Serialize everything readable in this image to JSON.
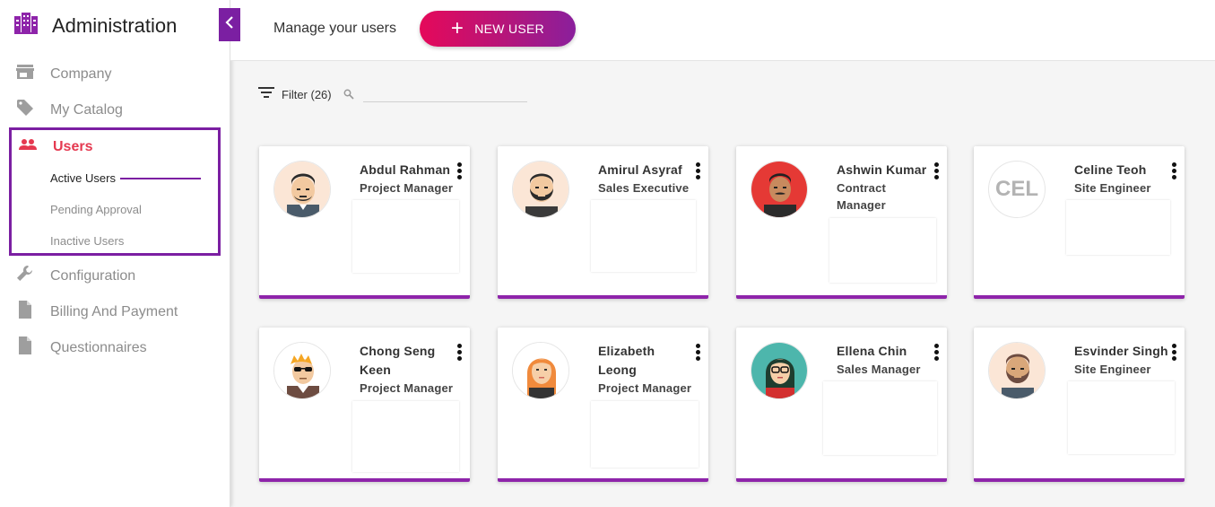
{
  "app": {
    "title": "Administration"
  },
  "sidebar": {
    "items": [
      {
        "label": "Company",
        "icon": "store-icon"
      },
      {
        "label": "My Catalog",
        "icon": "tag-icon"
      },
      {
        "label": "Users",
        "icon": "people-icon"
      },
      {
        "label": "Configuration",
        "icon": "wrench-icon"
      },
      {
        "label": "Billing And Payment",
        "icon": "document-icon"
      },
      {
        "label": "Questionnaires",
        "icon": "document-icon"
      }
    ],
    "users_subitems": [
      {
        "label": "Active Users"
      },
      {
        "label": "Pending Approval"
      },
      {
        "label": "Inactive Users"
      }
    ]
  },
  "header": {
    "title": "Manage your users",
    "new_user_label": "NEW USER"
  },
  "filter": {
    "label": "Filter (26)",
    "search_value": ""
  },
  "users": [
    {
      "name": "Abdul Rahman",
      "role": "Project Manager",
      "avatar": "man-beard-avatar"
    },
    {
      "name": "Amirul Asyraf",
      "role": "Sales Executive",
      "avatar": "man-full-beard-avatar"
    },
    {
      "name": "Ashwin Kumar",
      "role": "Contract Manager",
      "avatar": "man-mustache-red-avatar"
    },
    {
      "name": "Celine Teoh",
      "role": "Site Engineer",
      "avatar": "initials-avatar",
      "initials": "CEL"
    },
    {
      "name": "Chong Seng Keen",
      "role": "Project Manager",
      "avatar": "man-sunglasses-avatar"
    },
    {
      "name": "Elizabeth Leong",
      "role": "Project Manager",
      "avatar": "woman-redhead-avatar"
    },
    {
      "name": "Ellena Chin",
      "role": "Sales Manager",
      "avatar": "woman-glasses-avatar"
    },
    {
      "name": "Esvinder Singh",
      "role": "Site Engineer",
      "avatar": "man-bearded-avatar"
    }
  ],
  "colors": {
    "accent": "#7b1fa2",
    "active_nav": "#e53950",
    "button_gradient_start": "#e5095a",
    "button_gradient_end": "#8a1f9c"
  }
}
